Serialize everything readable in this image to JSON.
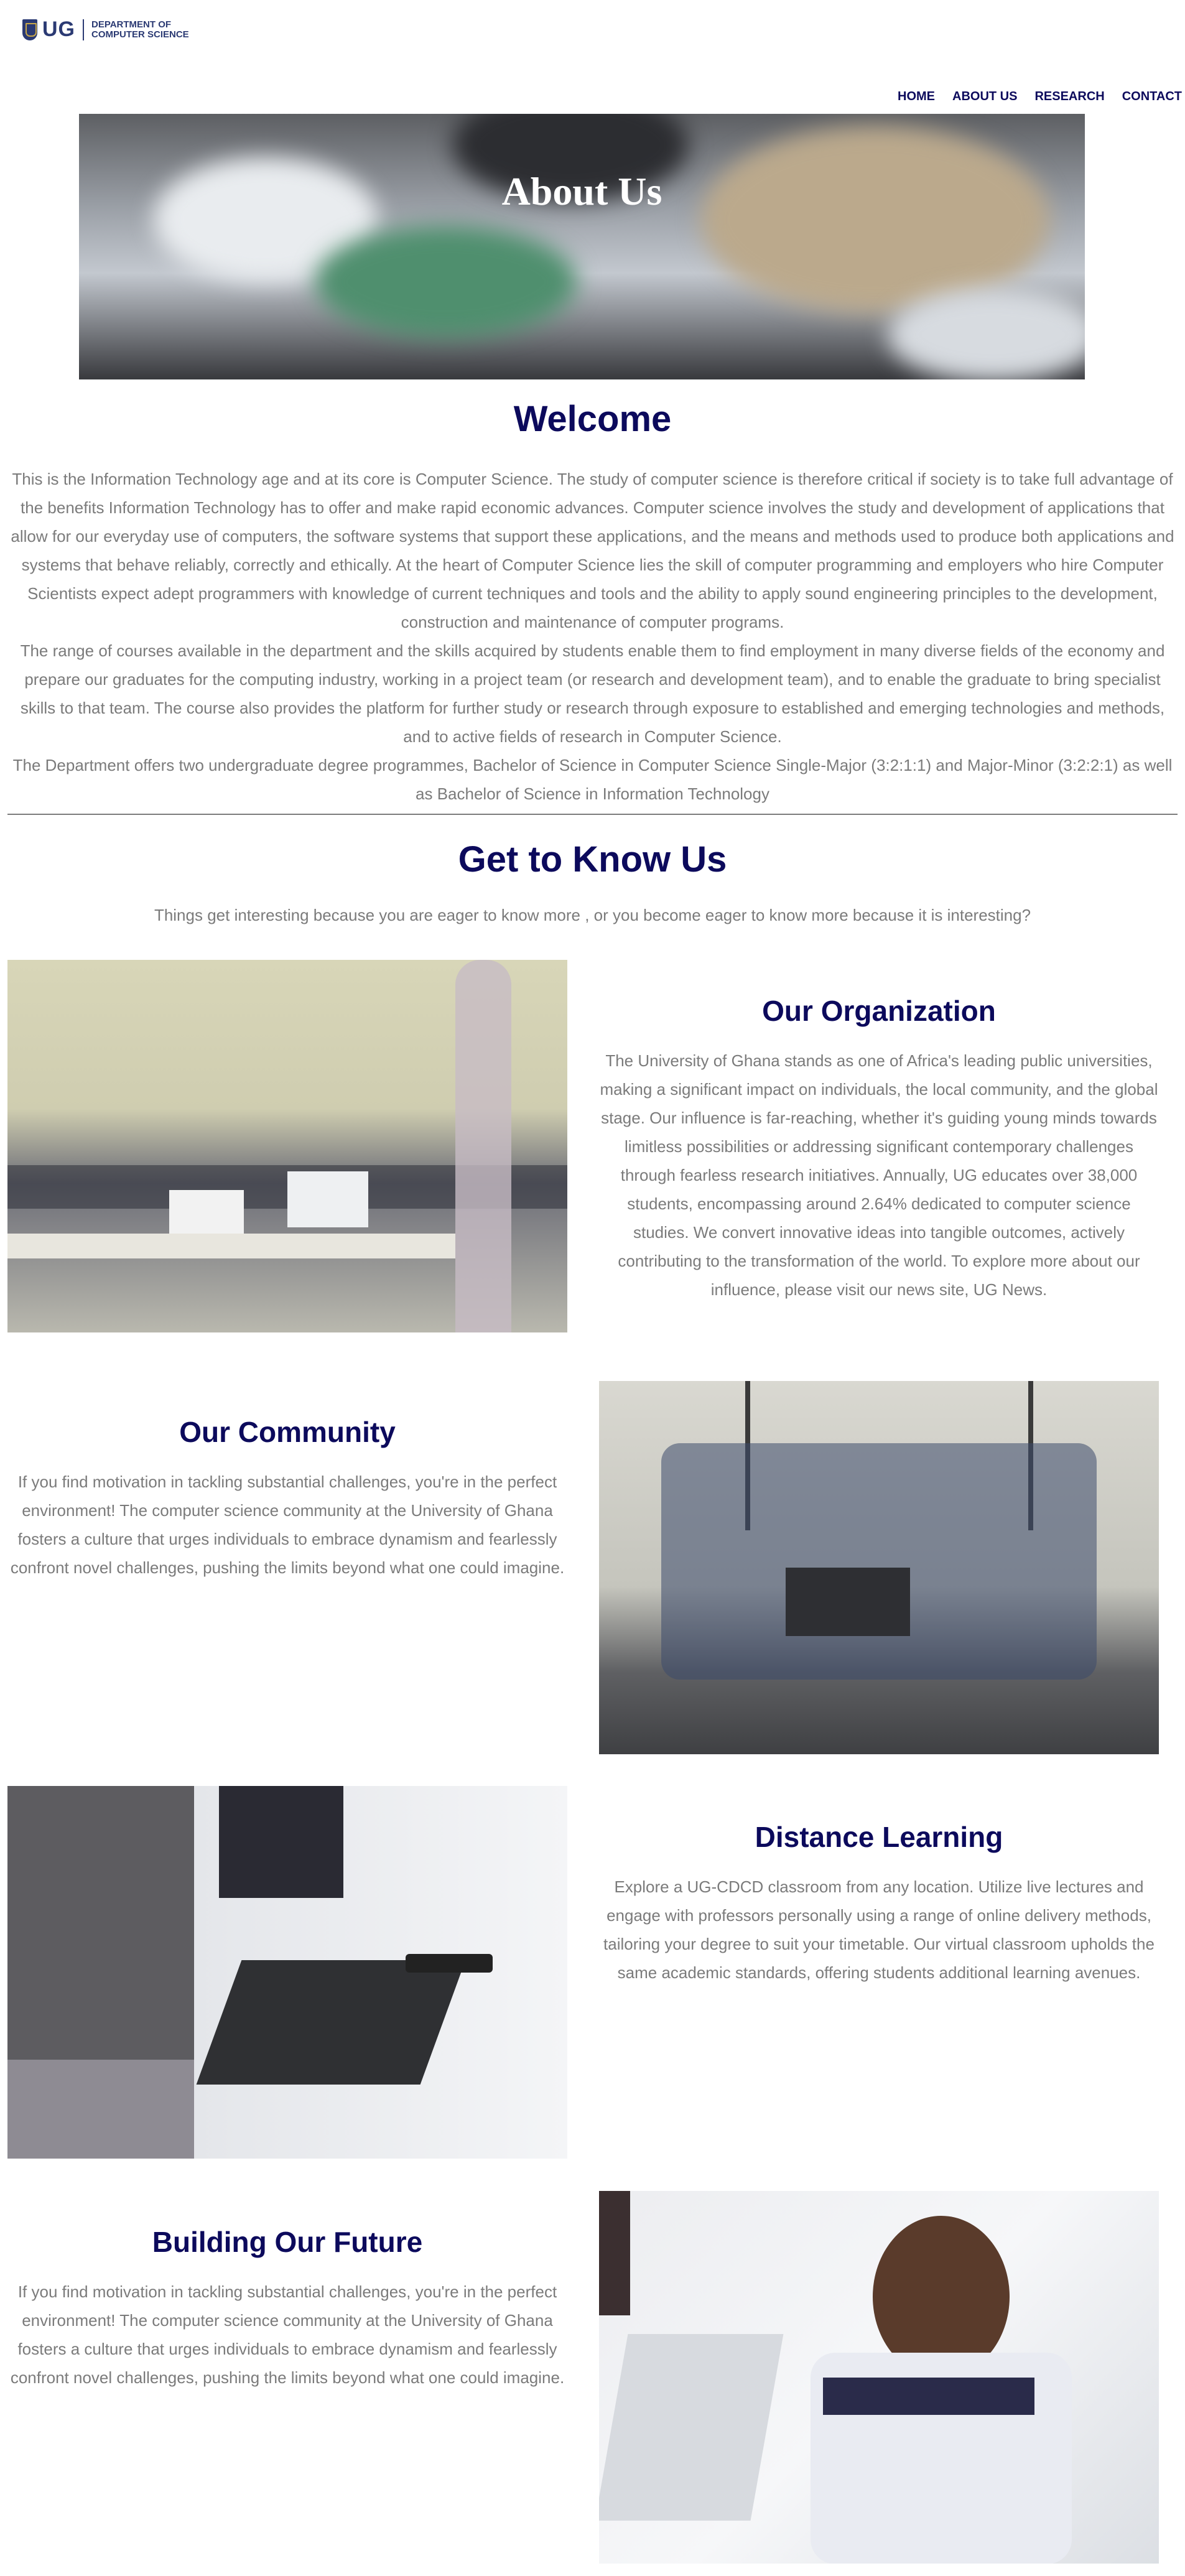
{
  "header": {
    "logo_text": "UG",
    "dept_line1": "DEPARTMENT OF",
    "dept_line2": "COMPUTER SCIENCE"
  },
  "nav": {
    "items": [
      "HOME",
      "ABOUT US",
      "RESEARCH",
      "CONTACT"
    ]
  },
  "hero": {
    "title": "About Us"
  },
  "welcome": {
    "title": "Welcome",
    "paragraphs": [
      "This is the Information Technology age and at its core is Computer Science. The study of computer science is therefore critical if society is to take full advantage of the benefits Information Technology has to offer and make rapid economic advances. Computer science involves the study and development of applications that allow for our everyday use of computers, the software systems that support these applications, and the means and methods used to produce both applications and systems that behave reliably, correctly and ethically. At the heart of Computer Science lies the skill of computer programming and employers who hire Computer Scientists expect adept programmers with knowledge of current techniques and tools and the ability to apply sound engineering principles to the development, construction and maintenance of computer programs.",
      "The range of courses available in the department and the skills acquired by students enable them to find employment in many diverse fields of the economy and prepare our graduates for the computing industry, working in a project team (or research and development team), and to enable the graduate to bring specialist skills to that team. The course also provides the platform for further study or research through exposure to established and emerging technologies and methods, and to active fields of research in Computer Science.",
      "The Department offers two undergraduate degree programmes, Bachelor of Science in Computer Science Single-Major (3:2:1:1) and Major-Minor (3:2:2:1) as well as Bachelor of Science in Information Technology"
    ]
  },
  "know": {
    "title": "Get to Know Us",
    "subtitle": "Things get interesting because you are eager to know more , or you become eager to know more because it is interesting?"
  },
  "features": [
    {
      "title": "Our Organization",
      "body": "The University of Ghana stands as one of Africa's leading public universities, making a significant impact on individuals, the local community, and the global stage. Our influence is far-reaching, whether it's guiding young minds towards limitless possibilities or addressing significant contemporary challenges through fearless research initiatives. Annually, UG educates over 38,000 students, encompassing around 2.64% dedicated to computer science studies. We convert innovative ideas into tangible outcomes, actively contributing to the transformation of the world. To explore more about our influence, please visit our news site, UG News."
    },
    {
      "title": "Our Community",
      "body": "If you find motivation in tackling substantial challenges, you're in the perfect environment! The computer science community at the University of Ghana fosters a culture that urges individuals to embrace dynamism and fearlessly confront novel challenges, pushing the limits beyond what one could imagine."
    },
    {
      "title": "Distance Learning",
      "body": "Explore a UG-CDCD classroom from any location. Utilize live lectures and engage with professors personally using a range of online delivery methods, tailoring your degree to suit your timetable. Our virtual classroom upholds the same academic standards, offering students additional learning avenues."
    },
    {
      "title": "Building Our Future",
      "body": "If you find motivation in tackling substantial challenges, you're in the perfect environment! The computer science community at the University of Ghana fosters a culture that urges individuals to embrace dynamism and fearlessly confront novel challenges, pushing the limits beyond what one could imagine."
    }
  ],
  "colors": {
    "accent": "#0c0a5c",
    "body_text": "#7b7b7b",
    "logo": "#2b3a73"
  }
}
